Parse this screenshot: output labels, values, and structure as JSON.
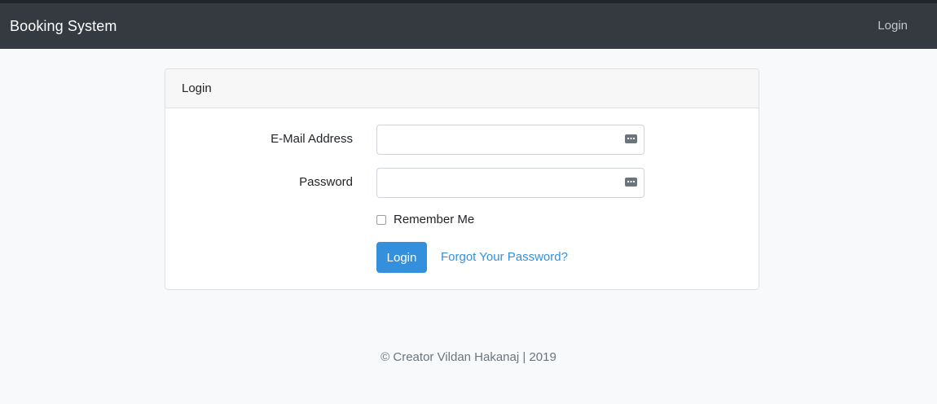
{
  "navbar": {
    "brand": "Booking System",
    "login_link": "Login"
  },
  "card": {
    "header": "Login",
    "email_label": "E-Mail Address",
    "email_value": "",
    "password_label": "Password",
    "password_value": "",
    "remember_label": "Remember Me",
    "remember_checked": false,
    "login_button": "Login",
    "forgot_link": "Forgot Your Password?"
  },
  "footer": {
    "text": "© Creator Vildan Hakanaj | 2019"
  },
  "icons": {
    "field_icon": "password-manager-icon"
  },
  "colors": {
    "navbar_bg": "#343a40",
    "primary": "#3490dc",
    "page_bg": "#f8f9fa"
  }
}
